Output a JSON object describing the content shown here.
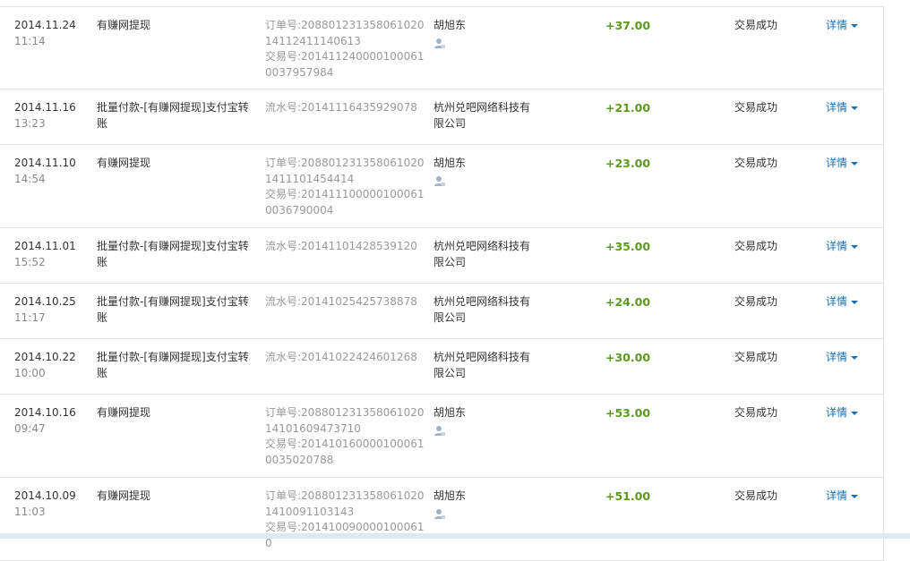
{
  "transactions": [
    {
      "date": "2014.11.24",
      "time": "11:14",
      "name": "有赚网提现",
      "ref": [
        "订单号:20880123135806102014112411140613",
        "交易号:2014112400001000610037957984"
      ],
      "party": "胡旭东",
      "has_person_icon": true,
      "amount": "+37.00",
      "status": "交易成功",
      "detail": "详情"
    },
    {
      "date": "2014.11.16",
      "time": "13:23",
      "name": "批量付款-[有赚网提现]支付宝转账",
      "ref": [
        "流水号:20141116435929078"
      ],
      "party": "杭州兑吧网络科技有限公司",
      "has_person_icon": false,
      "amount": "+21.00",
      "status": "交易成功",
      "detail": "详情"
    },
    {
      "date": "2014.11.10",
      "time": "14:54",
      "name": "有赚网提现",
      "ref": [
        "订单号:2088012313580610201411101454414",
        "交易号:2014111000001000610036790004"
      ],
      "party": "胡旭东",
      "has_person_icon": true,
      "amount": "+23.00",
      "status": "交易成功",
      "detail": "详情"
    },
    {
      "date": "2014.11.01",
      "time": "15:52",
      "name": "批量付款-[有赚网提现]支付宝转账",
      "ref": [
        "流水号:20141101428539120"
      ],
      "party": "杭州兑吧网络科技有限公司",
      "has_person_icon": false,
      "amount": "+35.00",
      "status": "交易成功",
      "detail": "详情"
    },
    {
      "date": "2014.10.25",
      "time": "11:17",
      "name": "批量付款-[有赚网提现]支付宝转账",
      "ref": [
        "流水号:20141025425738878"
      ],
      "party": "杭州兑吧网络科技有限公司",
      "has_person_icon": false,
      "amount": "+24.00",
      "status": "交易成功",
      "detail": "详情"
    },
    {
      "date": "2014.10.22",
      "time": "10:00",
      "name": "批量付款-[有赚网提现]支付宝转账",
      "ref": [
        "流水号:20141022424601268"
      ],
      "party": "杭州兑吧网络科技有限公司",
      "has_person_icon": false,
      "amount": "+30.00",
      "status": "交易成功",
      "detail": "详情"
    },
    {
      "date": "2014.10.16",
      "time": "09:47",
      "name": "有赚网提现",
      "ref": [
        "订单号:20880123135806102014101609473710",
        "交易号:2014101600001000610035020788"
      ],
      "party": "胡旭东",
      "has_person_icon": true,
      "amount": "+53.00",
      "status": "交易成功",
      "detail": "详情"
    },
    {
      "date": "2014.10.09",
      "time": "11:03",
      "name": "有赚网提现",
      "ref": [
        "订单号:2088012313580610201410091103143",
        "交易号:2014100900001000610"
      ],
      "party": "胡旭东",
      "has_person_icon": true,
      "amount": "+51.00",
      "status": "交易成功",
      "detail": "详情"
    }
  ],
  "colors": {
    "amount": "#5a9a1f",
    "link": "#1a6fb0",
    "muted": "#999999",
    "border": "#e4e4e4"
  },
  "icons": {
    "person": "person-icon",
    "caret": "caret-down-icon"
  }
}
